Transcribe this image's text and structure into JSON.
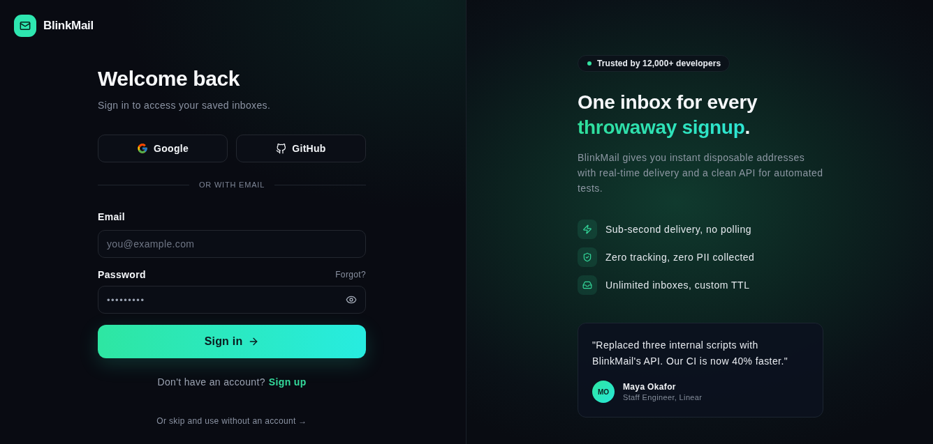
{
  "brand": {
    "name": "BlinkMail"
  },
  "sign_in": {
    "title": "Welcome back",
    "subtitle": "Sign in to access your saved inboxes.",
    "social_buttons": [
      {
        "kind": "google",
        "label": "Google"
      },
      {
        "kind": "github",
        "label": "GitHub"
      }
    ],
    "divider": "OR WITH EMAIL",
    "fields": [
      {
        "kind": "email",
        "label": "Email",
        "placeholder": "you@example.com"
      },
      {
        "kind": "password",
        "label": "Password",
        "link": "Forgot?",
        "value": "•••••••••"
      }
    ],
    "submit": "Sign in",
    "signup_prompt": "Don't have an account?",
    "signup_link": "Sign up",
    "skip_link": "Or skip and use without an account →"
  },
  "hero": {
    "badge": "Trusted by 12,000+ developers",
    "headline": "One inbox for every",
    "headline_accent": "throwaway signup",
    "headline_end": ".",
    "description": "BlinkMail gives you instant disposable addresses with real-time delivery and a clean API for automated tests.",
    "features": [
      {
        "kind": "bolt",
        "text": "Sub-second delivery, no polling"
      },
      {
        "kind": "shield",
        "text": "Zero tracking, zero PII collected"
      },
      {
        "kind": "inbox",
        "text": "Unlimited inboxes, custom TTL"
      }
    ],
    "testimonial": {
      "quote": "\"Replaced three internal scripts with BlinkMail's API. Our CI is now 40% faster.\"",
      "initials": "MO",
      "name": "Maya Okafor",
      "role": "Staff Engineer, Linear"
    }
  }
}
